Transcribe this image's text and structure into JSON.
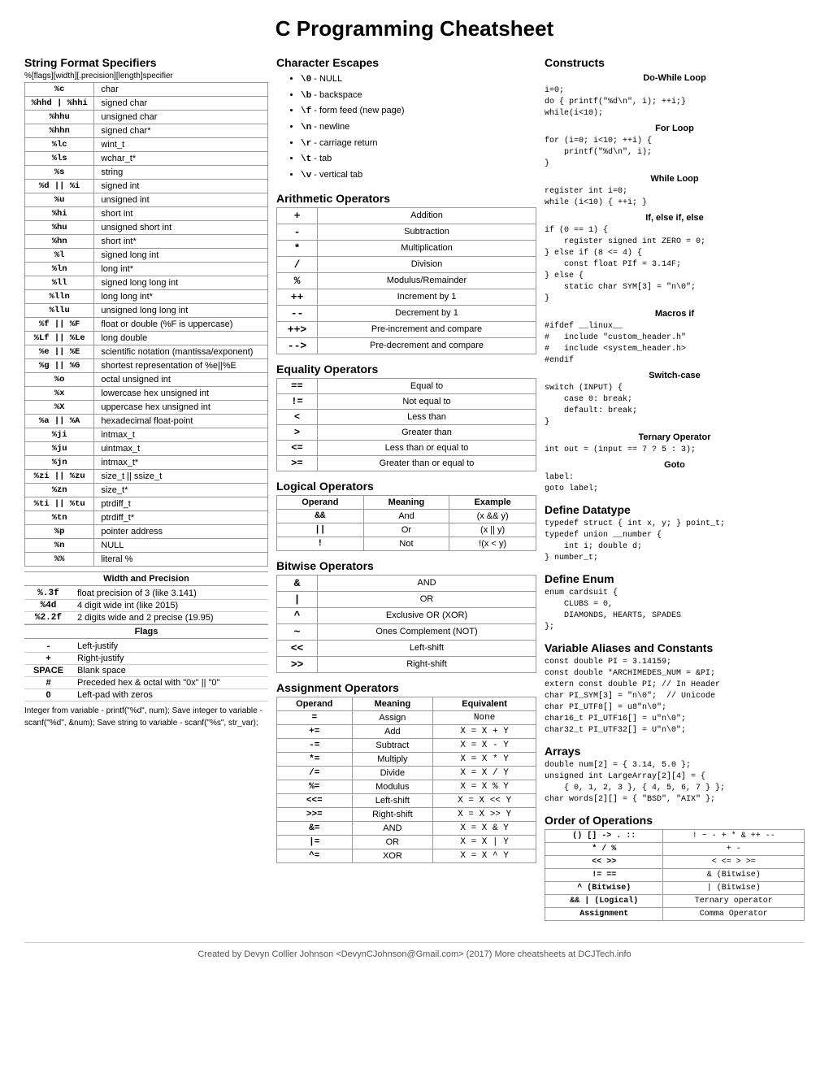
{
  "title": "C Programming Cheatsheet",
  "col1": {
    "string_format": {
      "title": "String Format Specifiers",
      "subtitle": "%[flags][width][.precision][length]specifier",
      "rows": [
        [
          "%c",
          "char"
        ],
        [
          "%hhd | %hhi",
          "signed char"
        ],
        [
          "%hhu",
          "unsigned char"
        ],
        [
          "%hhn",
          "signed char*"
        ],
        [
          "%lc",
          "wint_t"
        ],
        [
          "%ls",
          "wchar_t*"
        ],
        [
          "%s",
          "string"
        ],
        [
          "%d || %i",
          "signed int"
        ],
        [
          "%u",
          "unsigned int"
        ],
        [
          "%hi",
          "short int"
        ],
        [
          "%hu",
          "unsigned short int"
        ],
        [
          "%hn",
          "short int*"
        ],
        [
          "%l",
          "signed long int"
        ],
        [
          "%ln",
          "long int*"
        ],
        [
          "%ll",
          "signed long long int"
        ],
        [
          "%lln",
          "long long int*"
        ],
        [
          "%llu",
          "unsigned long long int"
        ],
        [
          "%f || %F",
          "float or double (%F is uppercase)"
        ],
        [
          "%Lf || %Le",
          "long double"
        ],
        [
          "%e || %E",
          "scientific notation (mantissa/exponent)"
        ],
        [
          "%g || %G",
          "shortest representation of %e||%E"
        ],
        [
          "%o",
          "octal unsigned int"
        ],
        [
          "%x",
          "lowercase hex unsigned int"
        ],
        [
          "%X",
          "uppercase hex unsigned int"
        ],
        [
          "%a || %A",
          "hexadecimal float-point"
        ],
        [
          "%ji",
          "intmax_t"
        ],
        [
          "%ju",
          "uintmax_t"
        ],
        [
          "%jn",
          "intmax_t*"
        ],
        [
          "%zi || %zu",
          "size_t || ssize_t"
        ],
        [
          "%zn",
          "size_t*"
        ],
        [
          "%ti || %tu",
          "ptrdiff_t"
        ],
        [
          "%tn",
          "ptrdiff_t*"
        ],
        [
          "%p",
          "pointer address"
        ],
        [
          "%n",
          "NULL"
        ],
        [
          "%%",
          "literal %"
        ]
      ],
      "width_precision": {
        "title": "Width and Precision",
        "rows": [
          [
            "%.3f",
            "float precision of 3 (like 3.141)"
          ],
          [
            "%4d",
            "4 digit wide int (like 2015)"
          ],
          [
            "%2.2f",
            "2 digits wide and 2 precise (19.95)"
          ]
        ]
      },
      "flags": {
        "title": "Flags",
        "rows": [
          [
            "-",
            "Left-justify"
          ],
          [
            "+",
            "Right-justify"
          ],
          [
            "SPACE",
            "Blank space"
          ],
          [
            "#",
            "Preceded hex & octal with \"0x\" || \"0\""
          ],
          [
            "0",
            "Left-pad with zeros"
          ]
        ]
      },
      "footnote": "Integer from variable - printf(\"%d\", num);\nSave integer to variable - scanf(\"%d\", &num);\nSave string to variable - scanf(\"%s\", str_var);"
    }
  },
  "col2": {
    "char_escapes": {
      "title": "Character Escapes",
      "items": [
        [
          "\\0",
          "NULL"
        ],
        [
          "\\b",
          "backspace"
        ],
        [
          "\\f",
          "form feed (new page)"
        ],
        [
          "\\n",
          "newline"
        ],
        [
          "\\r",
          "carriage return"
        ],
        [
          "\\t",
          "tab"
        ],
        [
          "\\v",
          "vertical tab"
        ]
      ]
    },
    "arithmetic": {
      "title": "Arithmetic Operators",
      "rows": [
        [
          "+",
          "Addition"
        ],
        [
          "-",
          "Subtraction"
        ],
        [
          "*",
          "Multiplication"
        ],
        [
          "/",
          "Division"
        ],
        [
          "%",
          "Modulus/Remainder"
        ],
        [
          "++",
          "Increment by 1"
        ],
        [
          "--",
          "Decrement by 1"
        ],
        [
          "++>",
          "Pre-increment and compare"
        ],
        [
          "-->",
          "Pre-decrement and compare"
        ]
      ]
    },
    "equality": {
      "title": "Equality Operators",
      "rows": [
        [
          "==",
          "Equal to"
        ],
        [
          "!=",
          "Not equal to"
        ],
        [
          "<",
          "Less than"
        ],
        [
          ">",
          "Greater than"
        ],
        [
          "<=",
          "Less than or equal to"
        ],
        [
          ">=",
          "Greater than or equal to"
        ]
      ]
    },
    "logical": {
      "title": "Logical Operators",
      "headers": [
        "Operand",
        "Meaning",
        "Example"
      ],
      "rows": [
        [
          "&&",
          "And",
          "(x && y)"
        ],
        [
          "||",
          "Or",
          "(x || y)"
        ],
        [
          "!",
          "Not",
          "!(x < y)"
        ]
      ]
    },
    "bitwise": {
      "title": "Bitwise Operators",
      "rows": [
        [
          "&",
          "AND"
        ],
        [
          "|",
          "OR"
        ],
        [
          "^",
          "Exclusive OR (XOR)"
        ],
        [
          "~",
          "Ones Complement (NOT)"
        ],
        [
          "<<",
          "Left-shift"
        ],
        [
          ">>",
          "Right-shift"
        ]
      ]
    },
    "assignment": {
      "title": "Assignment Operators",
      "headers": [
        "Operand",
        "Meaning",
        "Equivalent"
      ],
      "rows": [
        [
          "=",
          "Assign",
          "None"
        ],
        [
          "+=",
          "Add",
          "X = X + Y"
        ],
        [
          "-=",
          "Subtract",
          "X = X - Y"
        ],
        [
          "*=",
          "Multiply",
          "X = X * Y"
        ],
        [
          "/=",
          "Divide",
          "X = X / Y"
        ],
        [
          "%=",
          "Modulus",
          "X = X % Y"
        ],
        [
          "<<=",
          "Left-shift",
          "X = X << Y"
        ],
        [
          ">>=",
          "Right-shift",
          "X = X >> Y"
        ],
        [
          "&=",
          "AND",
          "X = X & Y"
        ],
        [
          "|=",
          "OR",
          "X = X | Y"
        ],
        [
          "^=",
          "XOR",
          "X = X ^ Y"
        ]
      ]
    }
  },
  "col3": {
    "constructs": {
      "title": "Constructs",
      "do_while": {
        "subtitle": "Do-While Loop",
        "code": "i=0;\ndo { printf(\"%d\\n\", i); ++i;}\nwhile(i<10);"
      },
      "for_loop": {
        "subtitle": "For Loop",
        "code": "for (i=0; i<10; ++i) {\n    printf(\"%d\\n\", i);\n}"
      },
      "while_loop": {
        "subtitle": "While Loop",
        "code": "register int i=0;\nwhile (i<10) { ++i; }"
      },
      "if_else": {
        "subtitle": "If, else if, else",
        "code": "if (0 == 1) {\n    register signed int ZERO = 0;\n} else if (8 <= 4) {\n    const float PIf = 3.14F;\n} else {\n    static char SYM[3] = \"n\\0\";\n}"
      },
      "macros_if": {
        "subtitle": "Macros if",
        "code": "#ifdef __linux__\n#   include \"custom_header.h\"\n#   include <system_header.h>\n#endif"
      },
      "switch_case": {
        "subtitle": "Switch-case",
        "code": "switch (INPUT) {\n    case 0: break;\n    default: break;\n}"
      },
      "ternary": {
        "subtitle": "Ternary Operator",
        "code": "int out = (input == 7 ? 5 : 3);"
      },
      "goto": {
        "subtitle": "Goto",
        "code": "label:\ngoto label;"
      }
    },
    "define_datatype": {
      "title": "Define Datatype",
      "code": "typedef struct { int x, y; } point_t;\ntypedef union __number {\n    int i; double d;\n} number_t;"
    },
    "define_enum": {
      "title": "Define Enum",
      "code": "enum cardsuit {\n    CLUBS = 0,\n    DIAMONDS, HEARTS, SPADES\n};"
    },
    "variable_aliases": {
      "title": "Variable Aliases and Constants",
      "code": "const double PI = 3.14159;\nconst double *ARCHIMEDES_NUM = &PI;\nextern const double PI; // In Header\nchar PI_SYM[3] = \"n\\0\";  // Unicode\nchar PI_UTF8[] = u8\"n\\0\";\nchar16_t PI_UTF16[] = u\"n\\0\";\nchar32_t PI_UTF32[] = U\"n\\0\";"
    },
    "arrays": {
      "title": "Arrays",
      "code": "double num[2] = { 3.14, 5.0 };\nunsigned int LargeArray[2][4] = {\n    { 0, 1, 2, 3 }, { 4, 5, 6, 7 } };\nchar words[2][] = { \"BSD\", \"AIX\" };"
    },
    "order_of_operations": {
      "title": "Order of Operations",
      "rows": [
        [
          "() [] -> . ::",
          "! ~ - + * & ++ --"
        ],
        [
          "* / %",
          "+ -"
        ],
        [
          "<< >>",
          "< <= > >="
        ],
        [
          "!= ==",
          "& (Bitwise)"
        ],
        [
          "^ (Bitwise)",
          "| (Bitwise)"
        ],
        [
          "&& | (Logical)",
          "Ternary operator"
        ],
        [
          "Assignment",
          "Comma Operator"
        ]
      ]
    }
  },
  "footer": "Created by Devyn Collier Johnson <DevynCJohnson@Gmail.com> (2017) More cheatsheets at DCJTech.info"
}
